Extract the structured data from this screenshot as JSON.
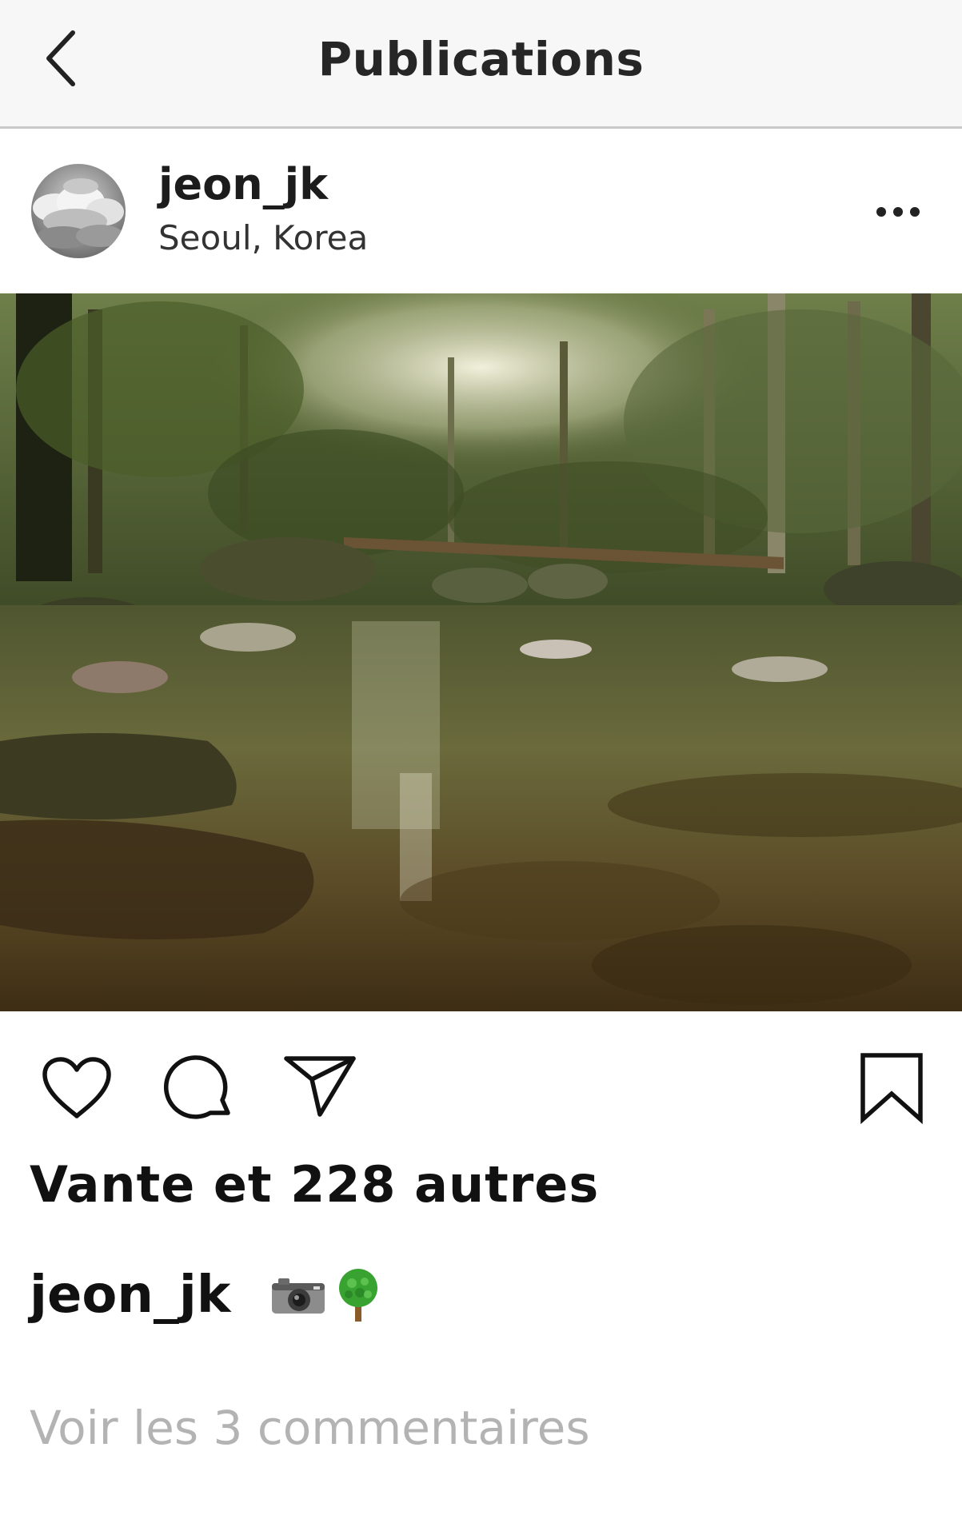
{
  "nav": {
    "title": "Publications"
  },
  "post": {
    "username": "jeon_jk",
    "location": "Seoul, Korea",
    "likes_text": "Vante et 228 autres",
    "caption_username": "jeon_jk",
    "caption_emojis": [
      "camera",
      "deciduous-tree"
    ],
    "view_comments": "Voir les 3 commentaires"
  },
  "icons": {
    "back": "chevron-left-icon",
    "more": "more-horizontal-icon",
    "like": "heart-icon",
    "comment": "comment-bubble-icon",
    "share": "paper-plane-icon",
    "save": "bookmark-icon"
  },
  "colors": {
    "topbar_bg": "#f7f7f7",
    "divider": "#c9c9c9",
    "text_primary": "#111111",
    "text_muted": "#b3b3b3"
  }
}
